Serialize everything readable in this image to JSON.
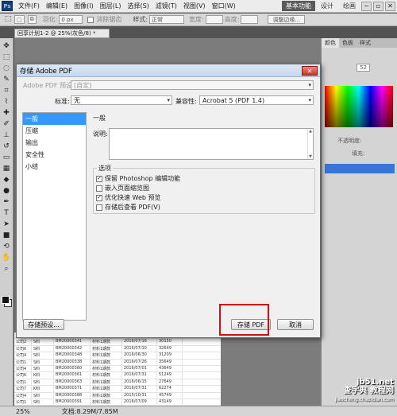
{
  "menubar": {
    "logo": "Ps",
    "items": [
      "文件(F)",
      "编辑(E)",
      "图像(I)",
      "图层(L)",
      "选择(S)",
      "滤镜(T)",
      "视图(V)",
      "窗口(W)"
    ],
    "workspaces": [
      "基本功能",
      "设计",
      "绘画"
    ],
    "window_buttons": [
      "−",
      "▫",
      "✕"
    ]
  },
  "options": {
    "feather_label": "羽化:",
    "feather_value": "0 px",
    "antialias_label": "消除锯齿",
    "style_label": "样式:",
    "style_value": "正常",
    "width_label": "宽度:",
    "height_label": "高度:",
    "refine_button": "调整边缘..."
  },
  "document_tab": "回享计划1-2 @ 25%(灰色/8) *",
  "right_panel": {
    "tabs": [
      "颜色",
      "色板",
      "样式"
    ],
    "value": "52",
    "opacity_label": "不透明度:",
    "fill_label": "填充:"
  },
  "dialog": {
    "title": "存储 Adobe PDF",
    "close": "✕",
    "preset_label": "Adobe PDF 预设:",
    "preset_value": "[自定]",
    "standard_label": "标准:",
    "standard_value": "无",
    "compat_label": "兼容性:",
    "compat_value": "Acrobat 5 (PDF 1.4)",
    "categories": [
      "一般",
      "压缩",
      "输出",
      "安全性",
      "小结"
    ],
    "section_title": "一般",
    "desc_label": "说明:",
    "options_legend": "选项",
    "checkboxes": [
      {
        "label": "保留 Photoshop 编辑功能",
        "checked": true
      },
      {
        "label": "嵌入页面缩览图",
        "checked": false
      },
      {
        "label": "优化快速 Web 预览",
        "checked": true
      },
      {
        "label": "存储后查看 PDF(V)",
        "checked": false
      }
    ],
    "save_preset_button": "存储预设...",
    "save_pdf_button": "存储 PDF",
    "cancel_button": "取消"
  },
  "sheet_rows": [
    [
      "公司6",
      "K料",
      "BM20000339",
      "材料1期款",
      "2015/05/01",
      "26009"
    ],
    [
      "公司2",
      "S料",
      "BM20000341",
      "材料1期款",
      "2016/07/16",
      "30150"
    ],
    [
      "公司6",
      "S料",
      "BM20000342",
      "材料1期款",
      "2016/07/10",
      "32649"
    ],
    [
      "公司4",
      "S料",
      "BM20000348",
      "材料1期款",
      "2016/06/30",
      "31209"
    ],
    [
      "公司1",
      "S料",
      "BM20000338",
      "材料1期款",
      "2016/07/26",
      "35649"
    ],
    [
      "公司4",
      "S料",
      "BM20000360",
      "材料1期款",
      "2016/07/01",
      "43649"
    ],
    [
      "公司6",
      "K料",
      "BM20000361",
      "材料1期款",
      "2016/07/31",
      "51249"
    ],
    [
      "公司1",
      "S料",
      "BM20000363",
      "材料1期款",
      "2016/06/15",
      "27649"
    ],
    [
      "公司7",
      "K料",
      "BM20000371",
      "材料1期款",
      "2016/07/31",
      "62274"
    ],
    [
      "公司4",
      "S料",
      "BM20000388",
      "材料1期款",
      "2015/10/31",
      "45749"
    ],
    [
      "公司1",
      "S料",
      "BM20000391",
      "材料1期款",
      "2016/07/09",
      "43149"
    ]
  ],
  "status": {
    "zoom": "25%",
    "doc_info": "文档:8.29M/7.85M"
  },
  "watermark": {
    "line1": "jb51.net",
    "line2": "查字典 教程网",
    "line3": "jiaocheng.chazidian.com"
  }
}
